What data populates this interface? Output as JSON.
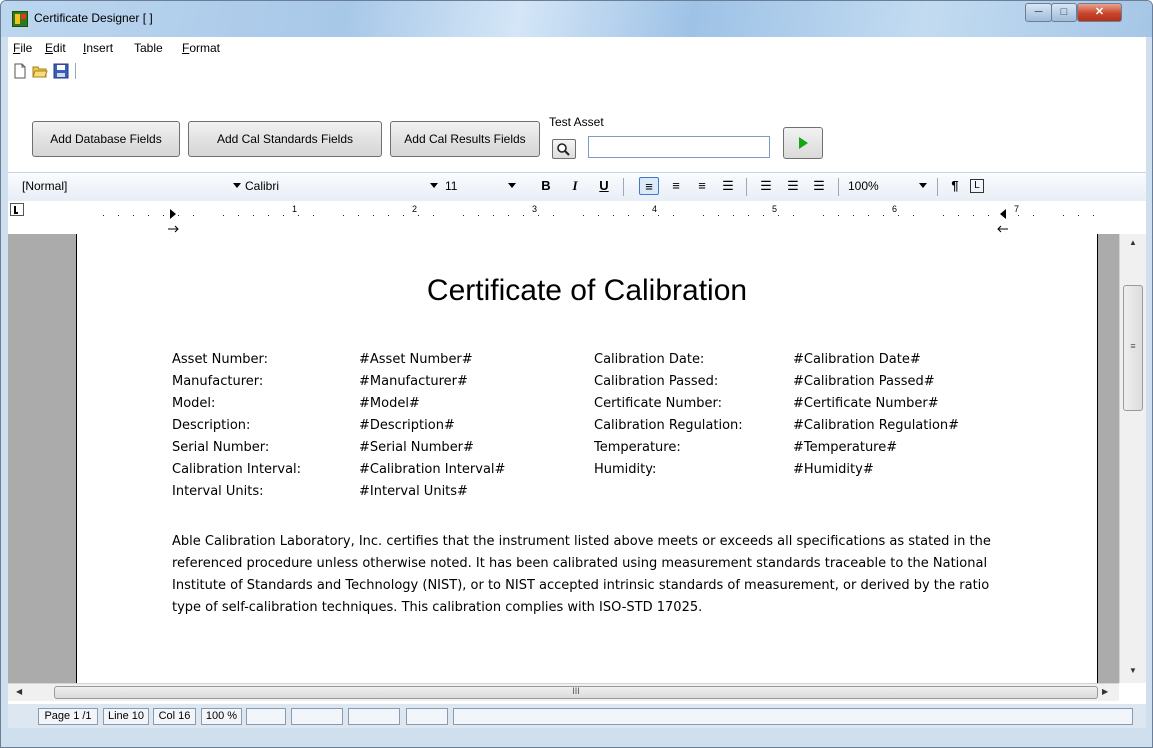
{
  "window": {
    "title": "Certificate Designer [ ]"
  },
  "menu": [
    {
      "label": "File",
      "accel": "F",
      "rest": "ile"
    },
    {
      "label": "Edit",
      "accel": "E",
      "rest": "dit"
    },
    {
      "label": "Insert",
      "accel": "I",
      "rest": "nsert"
    },
    {
      "label": "Table",
      "accel": "",
      "rest": "Table"
    },
    {
      "label": "Format",
      "accel": "F",
      "rest": "ormat"
    }
  ],
  "toolbar": {
    "add_db": "Add Database Fields",
    "add_cal_std": "Add Cal Standards Fields",
    "add_cal_results": "Add Cal Results Fields",
    "test_asset_label": "Test Asset",
    "test_asset_value": ""
  },
  "format_bar": {
    "style": "[Normal]",
    "font": "Calibri",
    "size": "11",
    "bold": "B",
    "italic": "I",
    "underline": "U",
    "zoom": "100%",
    "pilcrow": "¶"
  },
  "ruler": {
    "numbers": [
      "1",
      "2",
      "3",
      "4",
      "5",
      "6",
      "7"
    ]
  },
  "document": {
    "title": "Certificate of Calibration",
    "left_labels": [
      "Asset Number:",
      "Manufacturer:",
      "Model:",
      "Description:",
      "Serial Number:",
      "Calibration Interval:",
      "Interval Units:"
    ],
    "left_values": [
      "#Asset Number#",
      "#Manufacturer#",
      "#Model#",
      "#Description#",
      "#Serial Number#",
      "#Calibration Interval#",
      "#Interval Units#"
    ],
    "right_labels": [
      "Calibration Date:",
      "Calibration Passed:",
      "Certificate Number:",
      "Calibration Regulation:",
      "Temperature:",
      "Humidity:"
    ],
    "right_values": [
      "#Calibration Date#",
      "#Calibration Passed#",
      "#Certificate Number#",
      "#Calibration Regulation#",
      "#Temperature#",
      "#Humidity#"
    ],
    "paragraph": "Able Calibration Laboratory, Inc. certifies that the instrument listed above meets or exceeds all specifications as stated in the referenced procedure  unless otherwise  noted. It has been calibrated using measurement standards traceable to the National Institute of Standards and Technology (NIST), or to NIST accepted intrinsic standards of measurement, or derived by the ratio type of self-calibration techniques. This calibration complies with ISO-STD 17025."
  },
  "scrollbar": {
    "grip": "≡",
    "hgrip": "III"
  },
  "status": {
    "page": "Page 1 /1",
    "line": "Line 10",
    "col": "Col 16",
    "zoom": "100 %"
  }
}
